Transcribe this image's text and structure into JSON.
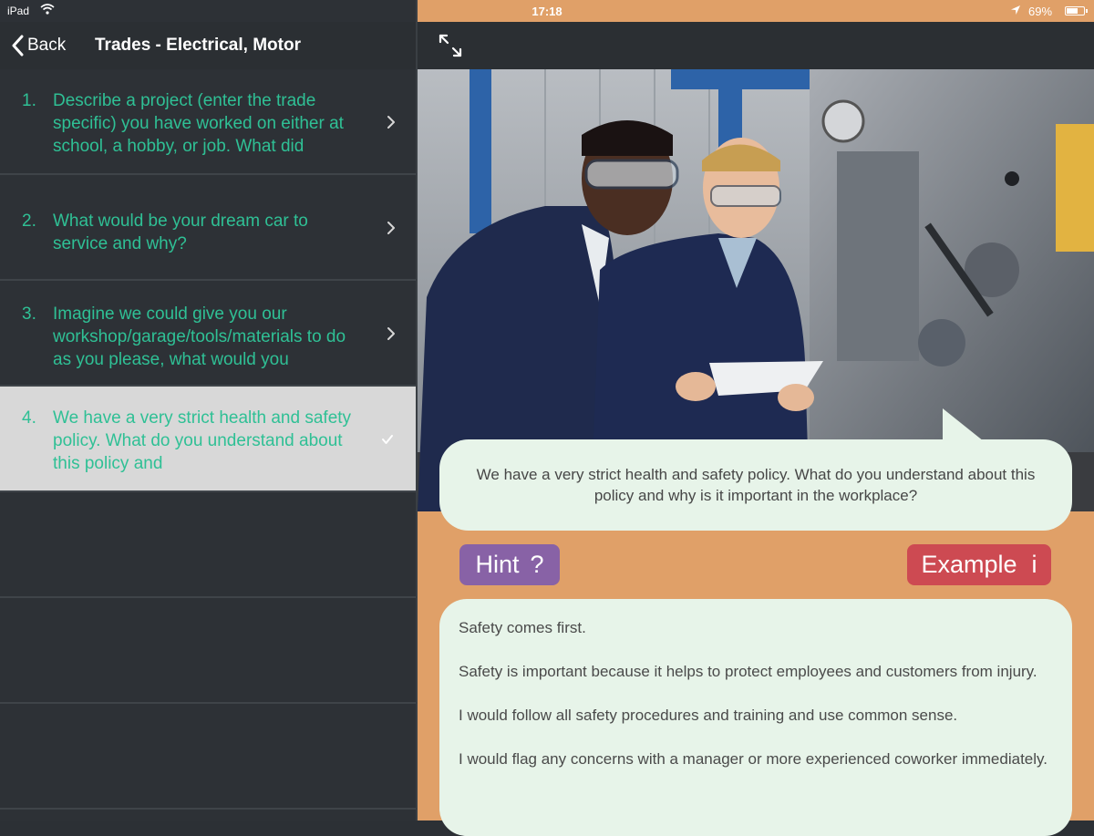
{
  "status_bar": {
    "device": "iPad",
    "time": "17:18",
    "battery": "69%",
    "battery_level": 0.69
  },
  "nav": {
    "back_label": "Back",
    "title": "Trades - Electrical, Motor"
  },
  "questions": [
    {
      "number": "1.",
      "text": "Describe a project (enter the trade specific) you have worked on either at school, a hobby, or job. What did"
    },
    {
      "number": "2.",
      "text": "What would be your dream car to service and why?"
    },
    {
      "number": "3.",
      "text": "Imagine we could give you our workshop/garage/tools/materials to do as you please, what would you"
    },
    {
      "number": "4.",
      "text": "We have a very strict health and safety policy. What do you understand about this policy and"
    }
  ],
  "selected_question_index": 3,
  "current_question": "We have a very strict health and safety policy. What do you understand about this policy and why is it important in the workplace?",
  "buttons": {
    "hint_label": "Hint",
    "hint_icon": "?",
    "example_label": "Example",
    "example_icon": "i"
  },
  "answer": {
    "p1": "Safety comes first.",
    "p2": "Safety is important because it helps to protect employees and customers from injury.",
    "p3": "I would follow all safety procedures and training and use common sense.",
    "p4": "I would flag any concerns with a manager or more experienced coworker immediately."
  },
  "colors": {
    "accent_green": "#2fc095",
    "hint_purple": "#8862a6",
    "example_red": "#cd4a52",
    "panel_orange": "#e0a068",
    "bubble_bg": "#e7f4e9"
  },
  "icons": {
    "wifi": "wifi-icon",
    "location": "location-arrow-icon",
    "back": "chevron-left-icon",
    "expand": "expand-arrows-icon",
    "row": "chevron-right-icon",
    "selected": "checkmark-icon"
  }
}
